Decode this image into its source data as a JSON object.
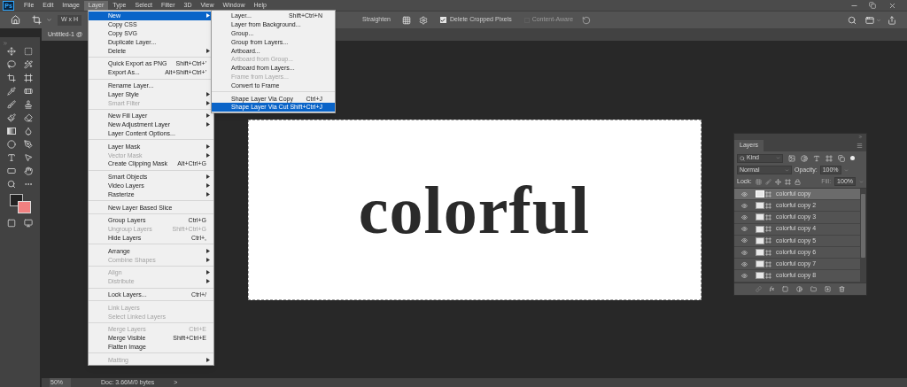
{
  "app_logo": "Ps",
  "menu_bar": [
    {
      "label": "File",
      "selected": false
    },
    {
      "label": "Edit",
      "selected": false
    },
    {
      "label": "Image",
      "selected": false
    },
    {
      "label": "Layer",
      "selected": true
    },
    {
      "label": "Type",
      "selected": false
    },
    {
      "label": "Select",
      "selected": false
    },
    {
      "label": "Filter",
      "selected": false
    },
    {
      "label": "3D",
      "selected": false
    },
    {
      "label": "View",
      "selected": false
    },
    {
      "label": "Window",
      "selected": false
    },
    {
      "label": "Help",
      "selected": false
    }
  ],
  "options_bar": {
    "ratio": "W x H",
    "straighten": "Straighten",
    "delete_cropped": {
      "label": "Delete Cropped Pixels",
      "checked": true
    },
    "content_aware": {
      "label": "Content-Aware",
      "disabled": true
    }
  },
  "document_tab": "Untitled-1 @",
  "canvas_text": "colorful",
  "layer_menu": [
    [
      {
        "label": "New",
        "submenu": true,
        "disabled": false,
        "selected": true
      },
      {
        "label": "Copy CSS",
        "submenu": false,
        "disabled": false,
        "selected": false
      },
      {
        "label": "Copy SVG",
        "submenu": false,
        "disabled": false,
        "selected": false
      },
      {
        "label": "Duplicate Layer...",
        "submenu": false,
        "disabled": false,
        "selected": false
      },
      {
        "label": "Delete",
        "submenu": true,
        "disabled": false,
        "selected": false
      }
    ],
    [
      {
        "label": "Quick Export as PNG",
        "shortcut": "Shift+Ctrl+'",
        "submenu": false,
        "disabled": false,
        "selected": false
      },
      {
        "label": "Export As...",
        "shortcut": "Alt+Shift+Ctrl+'",
        "submenu": false,
        "disabled": false,
        "selected": false
      }
    ],
    [
      {
        "label": "Rename Layer...",
        "submenu": false,
        "disabled": false,
        "selected": false
      },
      {
        "label": "Layer Style",
        "submenu": true,
        "disabled": false,
        "selected": false
      },
      {
        "label": "Smart Filter",
        "submenu": true,
        "disabled": true,
        "selected": false
      }
    ],
    [
      {
        "label": "New Fill Layer",
        "submenu": true,
        "disabled": false,
        "selected": false
      },
      {
        "label": "New Adjustment Layer",
        "submenu": true,
        "disabled": false,
        "selected": false
      },
      {
        "label": "Layer Content Options...",
        "submenu": false,
        "disabled": false,
        "selected": false
      }
    ],
    [
      {
        "label": "Layer Mask",
        "submenu": true,
        "disabled": false,
        "selected": false
      },
      {
        "label": "Vector Mask",
        "submenu": true,
        "disabled": true,
        "selected": false
      },
      {
        "label": "Create Clipping Mask",
        "shortcut": "Alt+Ctrl+G",
        "submenu": false,
        "disabled": false,
        "selected": false
      }
    ],
    [
      {
        "label": "Smart Objects",
        "submenu": true,
        "disabled": false,
        "selected": false
      },
      {
        "label": "Video Layers",
        "submenu": true,
        "disabled": false,
        "selected": false
      },
      {
        "label": "Rasterize",
        "submenu": true,
        "disabled": false,
        "selected": false
      }
    ],
    [
      {
        "label": "New Layer Based Slice",
        "submenu": false,
        "disabled": false,
        "selected": false
      }
    ],
    [
      {
        "label": "Group Layers",
        "shortcut": "Ctrl+G",
        "submenu": false,
        "disabled": false,
        "selected": false
      },
      {
        "label": "Ungroup Layers",
        "shortcut": "Shift+Ctrl+G",
        "submenu": false,
        "disabled": true,
        "selected": false
      },
      {
        "label": "Hide Layers",
        "shortcut": "Ctrl+,",
        "submenu": false,
        "disabled": false,
        "selected": false
      }
    ],
    [
      {
        "label": "Arrange",
        "submenu": true,
        "disabled": false,
        "selected": false
      },
      {
        "label": "Combine Shapes",
        "submenu": true,
        "disabled": true,
        "selected": false
      }
    ],
    [
      {
        "label": "Align",
        "submenu": true,
        "disabled": true,
        "selected": false
      },
      {
        "label": "Distribute",
        "submenu": true,
        "disabled": true,
        "selected": false
      }
    ],
    [
      {
        "label": "Lock Layers...",
        "shortcut": "Ctrl+/",
        "submenu": false,
        "disabled": false,
        "selected": false
      }
    ],
    [
      {
        "label": "Link Layers",
        "submenu": false,
        "disabled": true,
        "selected": false
      },
      {
        "label": "Select Linked Layers",
        "submenu": false,
        "disabled": true,
        "selected": false
      }
    ],
    [
      {
        "label": "Merge Layers",
        "shortcut": "Ctrl+E",
        "submenu": false,
        "disabled": true,
        "selected": false
      },
      {
        "label": "Merge Visible",
        "shortcut": "Shift+Ctrl+E",
        "submenu": false,
        "disabled": false,
        "selected": false
      },
      {
        "label": "Flatten Image",
        "submenu": false,
        "disabled": false,
        "selected": false
      }
    ],
    [
      {
        "label": "Matting",
        "submenu": true,
        "disabled": true,
        "selected": false
      }
    ]
  ],
  "new_submenu": [
    [
      {
        "label": "Layer...",
        "shortcut": "Shift+Ctrl+N",
        "disabled": false,
        "selected": false
      },
      {
        "label": "Layer from Background...",
        "disabled": false,
        "selected": false
      },
      {
        "label": "Group...",
        "disabled": false,
        "selected": false
      },
      {
        "label": "Group from Layers...",
        "disabled": false,
        "selected": false
      },
      {
        "label": "Artboard...",
        "disabled": false,
        "selected": false
      },
      {
        "label": "Artboard from Group...",
        "disabled": true,
        "selected": false
      },
      {
        "label": "Artboard from Layers...",
        "disabled": false,
        "selected": false
      },
      {
        "label": "Frame from Layers...",
        "disabled": true,
        "selected": false
      },
      {
        "label": "Convert to Frame",
        "disabled": false,
        "selected": false
      }
    ],
    [
      {
        "label": "Shape Layer Via Copy",
        "shortcut": "Ctrl+J",
        "disabled": false,
        "selected": false
      },
      {
        "label": "Shape Layer Via Cut",
        "shortcut": "Shift+Ctrl+J",
        "disabled": false,
        "selected": true
      }
    ]
  ],
  "layers_panel": {
    "tab": "Layers",
    "filter": "Kind",
    "blend_mode": "Normal",
    "opacity_label": "Opacity:",
    "opacity": "100%",
    "lock_label": "Lock:",
    "fill_label": "Fill:",
    "fill": "100%",
    "fx": "fx",
    "layers": [
      {
        "name": "colorful copy",
        "visible": true,
        "selected": true
      },
      {
        "name": "colorful copy 2",
        "visible": true,
        "selected": false
      },
      {
        "name": "colorful copy 3",
        "visible": true,
        "selected": false
      },
      {
        "name": "colorful copy 4",
        "visible": true,
        "selected": false
      },
      {
        "name": "colorful copy 5",
        "visible": true,
        "selected": false
      },
      {
        "name": "colorful copy 6",
        "visible": true,
        "selected": false
      },
      {
        "name": "colorful copy 7",
        "visible": true,
        "selected": false
      },
      {
        "name": "colorful copy 8",
        "visible": true,
        "selected": false
      }
    ]
  },
  "status_bar": {
    "zoom": "50%",
    "doc_size": "Doc: 3.66M/0 bytes",
    "arrow": ">"
  }
}
